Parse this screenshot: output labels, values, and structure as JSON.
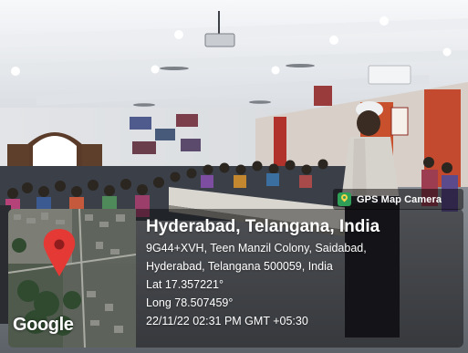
{
  "overlay": {
    "app_badge": "GPS Map Camera",
    "title": "Hyderabad, Telangana, India",
    "address_line1": "9G44+XVH, Teen Manzil Colony, Saidabad,",
    "address_line2": "Hyderabad, Telangana 500059, India",
    "latitude": "Lat 17.357221°",
    "longitude": "Long 78.507459°",
    "datetime": "22/11/22 02:31 PM GMT +05:30",
    "map_brand": "Google"
  },
  "icons": {
    "badge_icon": "map-pin-icon",
    "map_marker": "map-marker-icon"
  },
  "colors": {
    "overlay_background": "#000000",
    "overlay_text": "#ffffff",
    "marker_red": "#e53935",
    "badge_green": "#2f9e57"
  }
}
